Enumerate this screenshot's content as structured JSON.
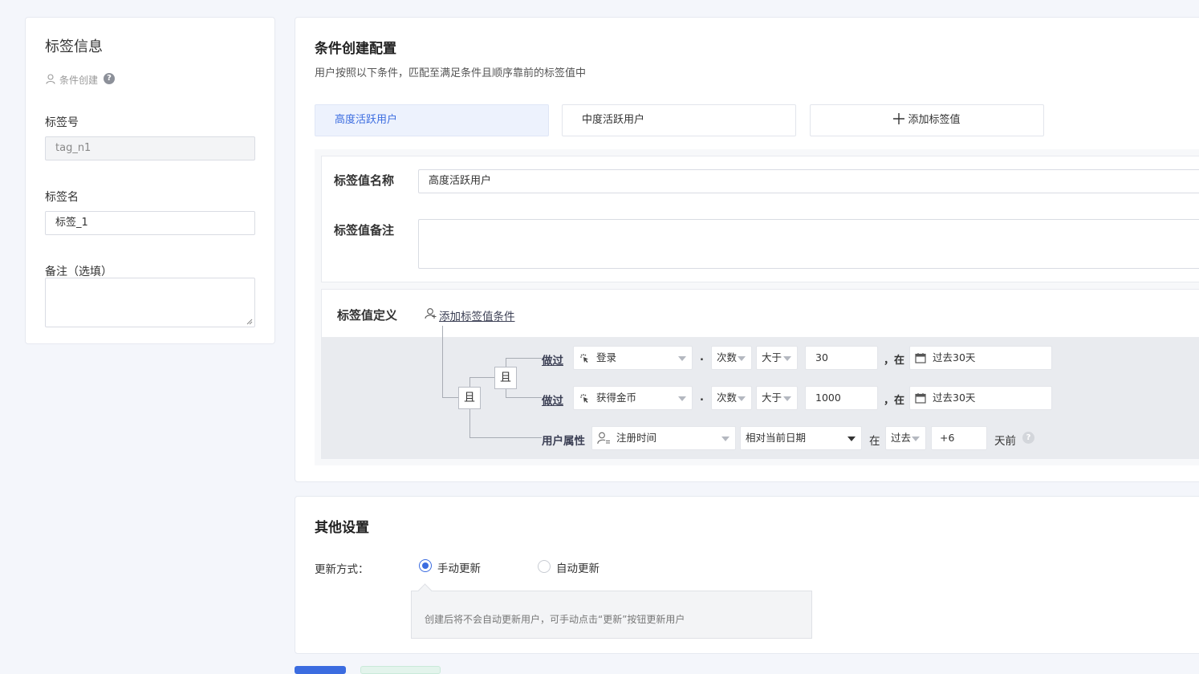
{
  "left_panel": {
    "title": "标签信息",
    "creation_type": "条件创建",
    "tag_no_label": "标签号",
    "tag_no_value": "tag_n1",
    "tag_name_label": "标签名",
    "tag_name_value": "标签_1",
    "note_label": "备注（选填）"
  },
  "config": {
    "title": "条件创建配置",
    "subtitle": "用户按照以下条件，匹配至满足条件且顺序靠前的标签值中",
    "tabs": [
      "高度活跃用户",
      "中度活跃用户"
    ],
    "active_tab": 0,
    "add_tab_label": "添加标签值",
    "value_name_label": "标签值名称",
    "value_name_value": "高度活跃用户",
    "value_note_label": "标签值备注",
    "definition_label": "标签值定义",
    "add_condition_label": "添加标签值条件",
    "logic_outer": "且",
    "logic_inner": "且",
    "conditions": [
      {
        "type": "做过",
        "event": "登录",
        "metric": "次数",
        "operator": "大于",
        "value": "30",
        "in_label": "，在",
        "time_range": "过去30天"
      },
      {
        "type": "做过",
        "event": "获得金币",
        "metric": "次数",
        "operator": "大于",
        "value": "1000",
        "in_label": "，在",
        "time_range": "过去30天"
      }
    ],
    "attr_condition": {
      "type": "用户属性",
      "attribute": "注册时间",
      "mode": "相对当前日期",
      "in_label": "在",
      "direction": "过去",
      "value": "+6",
      "suffix": "天前"
    },
    "dot": "."
  },
  "other": {
    "title": "其他设置",
    "update_label": "更新方式：",
    "options": [
      "手动更新",
      "自动更新"
    ],
    "selected": 0,
    "hint": "创建后将不会自动更新用户，可手动点击“更新”按钮更新用户"
  },
  "colors": {
    "accent": "#3b6ce0",
    "panel_bg": "#e9ebef"
  }
}
